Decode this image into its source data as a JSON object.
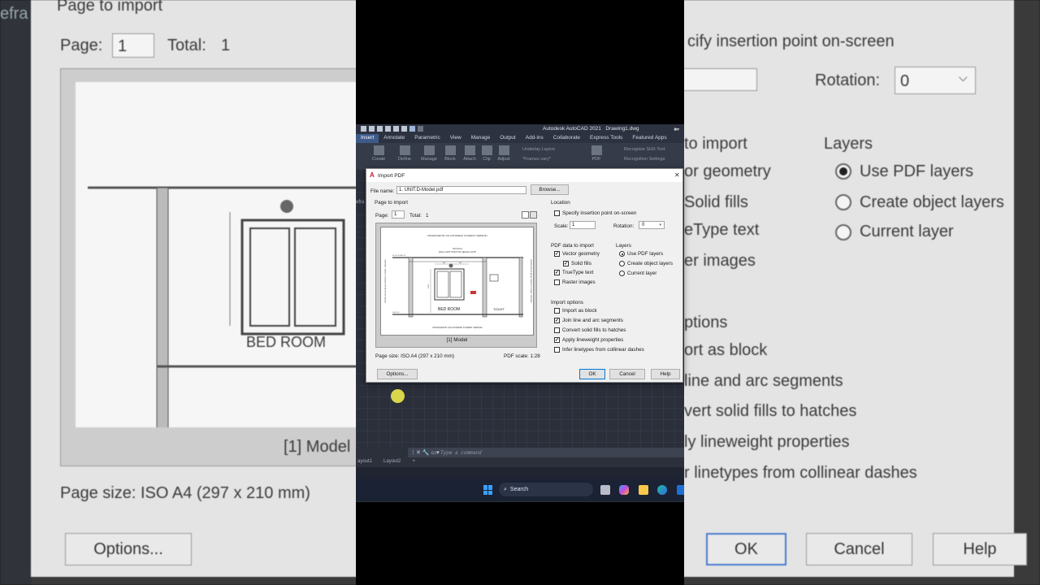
{
  "app": {
    "title": "Autodesk AutoCAD 2021",
    "file": "Drawing1.dwg",
    "ribbon_tabs": [
      "Insert",
      "Annotate",
      "Parametric",
      "View",
      "Manage",
      "Output",
      "Add-ins",
      "Collaborate",
      "Express Tools",
      "Featured Apps"
    ],
    "active_tab": "Insert",
    "ribbon_buttons": [
      "Create",
      "Define",
      "Manage",
      "Block",
      "Attach",
      "Clip",
      "Adjust",
      "PDF"
    ],
    "ribbon_text": {
      "underlay": "Underlay Layers",
      "frames": "*Frames vary*",
      "recognize": "Recognize SHX Text",
      "recognition": "Recognition Settings"
    },
    "viewport_label": "efra",
    "command_placeholder": "Type a command",
    "layout_tabs": [
      "ayout1",
      "Layout2",
      "+"
    ]
  },
  "taskbar": {
    "search_label": "Search"
  },
  "dialog": {
    "title": "Import PDF",
    "file_name_label": "File name:",
    "file_name_value": "1. UNIT.D-Model.pdf",
    "browse_label": "Browse...",
    "page_to_import": {
      "section_label": "Page to import",
      "page_label": "Page:",
      "page_value": "1",
      "total_label": "Total:",
      "total_value": "1",
      "model_caption": "[1] Model",
      "page_size": "Page size: ISO A4 (297 x 210 mm)",
      "pdf_scale": "PDF scale: 1:28"
    },
    "location": {
      "section_label": "Location",
      "specify_onscreen_label": "Specify insertion point on-screen",
      "specify_onscreen_checked": false,
      "scale_label": "Scale:",
      "scale_value": "1",
      "rotation_label": "Rotation:",
      "rotation_value": "0"
    },
    "pdf_data": {
      "section_label": "PDF data to import",
      "items": [
        {
          "label": "Vector geometry",
          "checked": true
        },
        {
          "label": "Solid fills",
          "checked": true
        },
        {
          "label": "TrueType text",
          "checked": true
        },
        {
          "label": "Raster images",
          "checked": false
        }
      ]
    },
    "layers": {
      "section_label": "Layers",
      "options": [
        {
          "label": "Use PDF layers",
          "selected": true
        },
        {
          "label": "Create object layers",
          "selected": false
        },
        {
          "label": "Current layer",
          "selected": false
        }
      ]
    },
    "import_options": {
      "section_label": "Import options",
      "items": [
        {
          "label": "Import as block",
          "checked": false
        },
        {
          "label": "Join line and arc segments",
          "checked": true
        },
        {
          "label": "Convert solid fills to hatches",
          "checked": false
        },
        {
          "label": "Apply lineweight properties",
          "checked": true
        },
        {
          "label": "Infer linetypes from collinear dashes",
          "checked": false
        }
      ]
    },
    "buttons": {
      "options": "Options...",
      "ok": "OK",
      "cancel": "Cancel",
      "help": "Help"
    }
  },
  "drawing_preview": {
    "header": "PRODUCED BY AN AUTODESK STUDENT VERSION",
    "footer": "PRODUCED BY AN AUTODESK STUDENT VERSION",
    "side": "PRODUCED BY AN AUTODESK STUDENT VERSION",
    "note": "WALL LIGHT POINT OR CEILING LIGHT",
    "revision": "REVISION",
    "level_top": "ROOF SLAB LVL",
    "level_bottom": "FGB LVL",
    "eq": "EQ",
    "dim": "1700",
    "room1": "BED ROOM",
    "room2": "TOILET"
  },
  "background": {
    "page_to_import": "Page to import",
    "page_label": "Page:",
    "page_value": "1",
    "total_label": "Total:",
    "total_value": "1",
    "model_caption": "[1] Model",
    "page_size": "Page size: ISO A4 (297 x 210 mm)",
    "options_btn": "Options...",
    "specify": "cify insertion point on-screen",
    "rotation_label": "Rotation:",
    "rotation_value": "0",
    "to_import": "to import",
    "vector": "or geometry",
    "solid": "Solid fills",
    "truetype": "eType text",
    "raster": "er images",
    "layers_label": "Layers",
    "layer_opts": [
      "Use PDF layers",
      "Create object layers",
      "Current layer"
    ],
    "options_label": "ptions",
    "opt_items": [
      "ort as block",
      "line and arc segments",
      "vert solid fills to hatches",
      "ly lineweight properties",
      "r linetypes from collinear dashes"
    ],
    "ok": "OK",
    "cancel": "Cancel",
    "help": "Help",
    "left_edge": "efra",
    "room": "BED ROOM"
  }
}
